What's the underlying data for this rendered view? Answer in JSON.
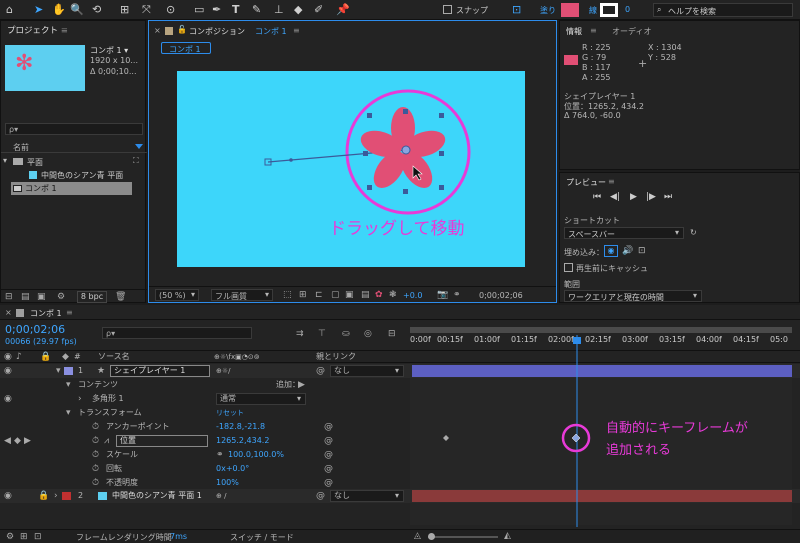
{
  "toolbar": {
    "snap_label": "スナップ",
    "fill_label": "塗り",
    "stroke_label": "線",
    "stroke_value": "0",
    "help_search": "ヘルプを検索"
  },
  "project": {
    "title": "プロジェクト",
    "comp_name": "コンポ 1 ▾",
    "comp_size": "1920 x 10...",
    "comp_delta": "Δ 0;00;10...",
    "search_placeholder": "ρ▾",
    "name_header": "名前",
    "items": [
      {
        "label": "平面"
      },
      {
        "label": "中間色のシアン青 平面"
      },
      {
        "label": "コンポ 1"
      }
    ],
    "bpc": "8 bpc"
  },
  "composition": {
    "title": "コンポジション",
    "comp_link": "コンポ 1",
    "tab": "コンポ 1",
    "overlay_text": "ドラッグして移動",
    "zoom": "(50 %)",
    "quality": "フル画質",
    "exposure": "+0.0",
    "timecode": "0;00;02;06"
  },
  "info": {
    "tab_info": "情報",
    "tab_audio": "オーディオ",
    "r": "R : 225",
    "g": "G : 79",
    "b": "B : 117",
    "a": "A : 255",
    "x": "X : 1304",
    "y": "Y : 528",
    "layer_name": "シェイプレイヤー 1",
    "position": "位置：1265.2, 434.2",
    "delta": "Δ 764.0, -60.0",
    "color": "#e14f75"
  },
  "preview": {
    "title": "プレビュー",
    "shortcut_label": "ショートカット",
    "shortcut_value": "スペースバー",
    "embed_label": "埋め込み：",
    "cache_label": "再生前にキャッシュ",
    "range_label": "範囲",
    "range_value": "ワークエリアと現在の時間"
  },
  "timeline": {
    "tab": "コンポ 1",
    "timecode": "0;00;02;06",
    "frames": "00066 (29.97 fps)",
    "search_placeholder": "ρ▾",
    "col_source": "ソース名",
    "col_parent": "親とリンク",
    "ticks": [
      "0:00f",
      "00:15f",
      "01:00f",
      "01:15f",
      "02:00f",
      "02:15f",
      "03:00f",
      "03:15f",
      "04:00f",
      "04:15f",
      "05:0"
    ],
    "layer1": {
      "num": "1",
      "name": "シェイプレイヤー 1",
      "parent": "なし"
    },
    "contents": "コンテンツ",
    "add_label": "追加：",
    "polygon": "多角形 1",
    "blend": "通常",
    "transform": "トランスフォーム",
    "reset": "リセット",
    "props": [
      {
        "name": "アンカーポイント",
        "value": "-182.8,-21.8"
      },
      {
        "name": "位置",
        "value": "1265.2,434.2"
      },
      {
        "name": "スケール",
        "value": "100.0,100.0%"
      },
      {
        "name": "回転",
        "value": "0x+0.0°"
      },
      {
        "name": "不透明度",
        "value": "100%"
      }
    ],
    "layer2": {
      "num": "2",
      "name": "中間色のシアン青 平面 1",
      "parent": "なし"
    },
    "annotation_line1": "自動的にキーフレームが",
    "annotation_line2": "追加される",
    "footer_render": "フレームレンダリング時間",
    "footer_ms": "7ms",
    "footer_switch": "スイッチ / モード"
  }
}
